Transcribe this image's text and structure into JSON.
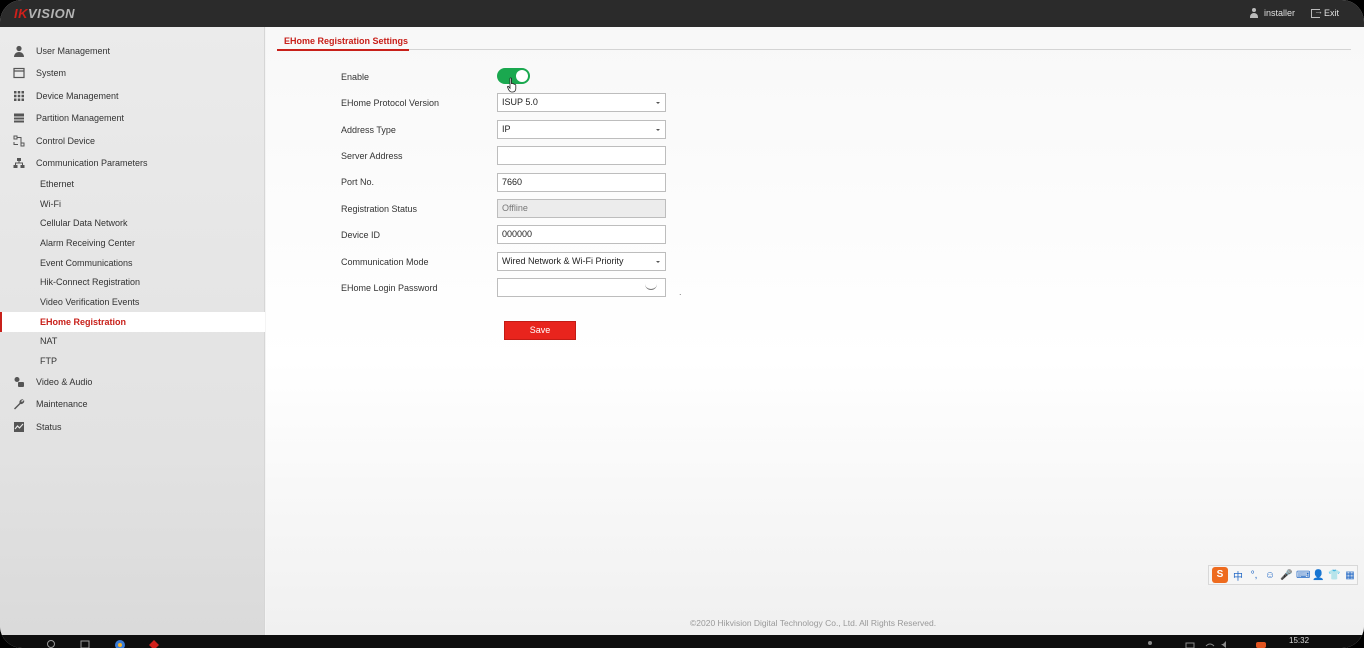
{
  "header": {
    "brand_red": "IK",
    "brand_rest": "VISION",
    "user": "installer",
    "exit_label": "Exit"
  },
  "sidebar": {
    "items": [
      {
        "label": "User Management",
        "icon": "user-icon"
      },
      {
        "label": "System",
        "icon": "system-icon"
      },
      {
        "label": "Device Management",
        "icon": "device-grid-icon"
      },
      {
        "label": "Partition Management",
        "icon": "partition-icon"
      },
      {
        "label": "Control Device",
        "icon": "control-icon"
      },
      {
        "label": "Communication Parameters",
        "icon": "network-icon"
      }
    ],
    "sub_items": [
      {
        "label": "Ethernet"
      },
      {
        "label": "Wi-Fi"
      },
      {
        "label": "Cellular Data Network"
      },
      {
        "label": "Alarm Receiving Center"
      },
      {
        "label": "Event Communications"
      },
      {
        "label": "Hik-Connect Registration"
      },
      {
        "label": "Video Verification Events"
      },
      {
        "label": "EHome Registration",
        "active": true
      },
      {
        "label": "NAT"
      },
      {
        "label": "FTP"
      }
    ],
    "bottom_items": [
      {
        "label": "Video & Audio",
        "icon": "video-audio-icon"
      },
      {
        "label": "Maintenance",
        "icon": "wrench-icon"
      },
      {
        "label": "Status",
        "icon": "status-icon"
      }
    ]
  },
  "main": {
    "tab": "EHome Registration Settings",
    "form": {
      "enable_label": "Enable",
      "enable_on": true,
      "protocol_label": "EHome Protocol Version",
      "protocol_value": "ISUP 5.0",
      "address_type_label": "Address Type",
      "address_type_value": "IP",
      "server_address_label": "Server Address",
      "server_address_value": "",
      "port_label": "Port No.",
      "port_value": "7660",
      "reg_status_label": "Registration Status",
      "reg_status_value": "Offline",
      "device_id_label": "Device ID",
      "device_id_value": "000000",
      "comm_mode_label": "Communication Mode",
      "comm_mode_value": "Wired Network & Wi-Fi Priority",
      "password_label": "EHome Login Password",
      "password_value": "",
      "trailing_mark": "."
    },
    "save_label": "Save"
  },
  "footer": {
    "copyright": "©2020 Hikvision Digital Technology Co., Ltd. All Rights Reserved."
  },
  "ime": {
    "logo": "S",
    "chinese": "中",
    "punct": "°,",
    "emoji": "☺",
    "mic": "🎤",
    "keyboard": "⌨",
    "user": "👤",
    "shirt": "👕",
    "grid": "▦"
  },
  "taskbar": {
    "time": "15:32"
  },
  "colors": {
    "accent_red": "#c8201a",
    "toggle_green": "#1aa84f",
    "save_red": "#e8241d"
  }
}
